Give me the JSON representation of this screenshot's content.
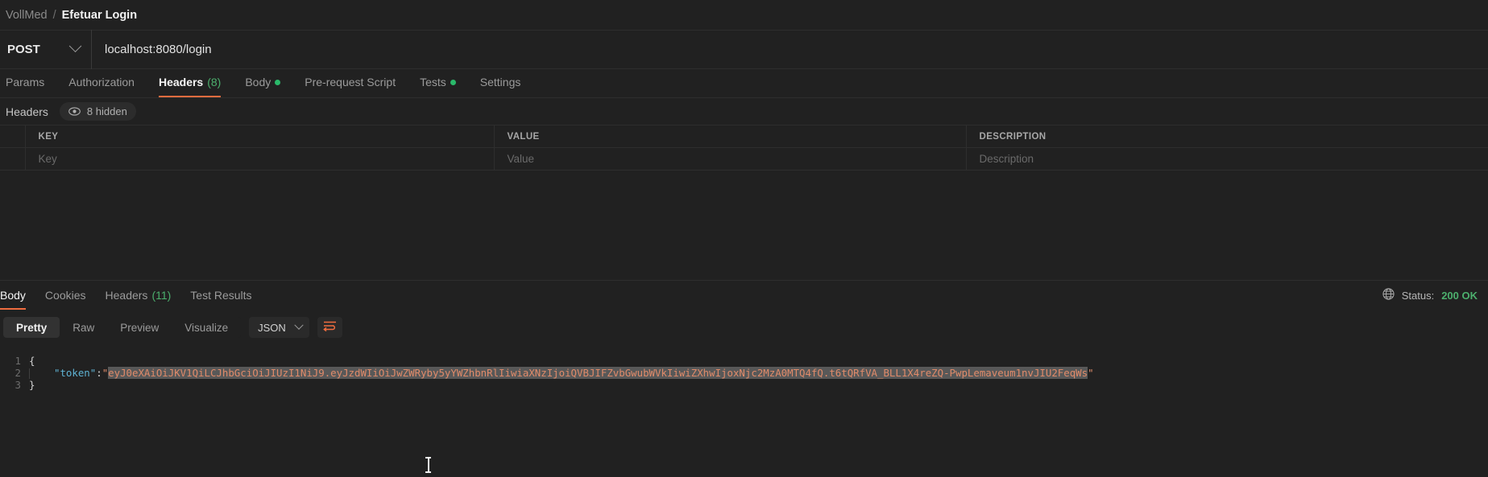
{
  "breadcrumb": {
    "collection": "VollMed",
    "separator": "/",
    "request": "Efetuar Login"
  },
  "urlbar": {
    "method": "POST",
    "url": "localhost:8080/login"
  },
  "request_tabs": [
    {
      "label": "Params",
      "active": false
    },
    {
      "label": "Authorization",
      "active": false
    },
    {
      "label": "Headers",
      "count": "(8)",
      "active": true
    },
    {
      "label": "Body",
      "dot": true,
      "active": false
    },
    {
      "label": "Pre-request Script",
      "active": false
    },
    {
      "label": "Tests",
      "dot": true,
      "active": false
    },
    {
      "label": "Settings",
      "active": false
    }
  ],
  "headers_section": {
    "label": "Headers",
    "hidden_badge": "8 hidden",
    "eye_icon": "eye-icon",
    "columns": [
      "KEY",
      "VALUE",
      "DESCRIPTION"
    ],
    "placeholder_row": {
      "key": "Key",
      "value": "Value",
      "description": "Description"
    }
  },
  "response_tabs": [
    {
      "label": "Body",
      "active": true
    },
    {
      "label": "Cookies",
      "active": false
    },
    {
      "label": "Headers",
      "count": "(11)",
      "active": false
    },
    {
      "label": "Test Results",
      "active": false
    }
  ],
  "response_status": {
    "globe_icon": "globe-icon",
    "label": "Status:",
    "value": "200 OK"
  },
  "body_toolbar": {
    "views": [
      {
        "label": "Pretty",
        "active": true
      },
      {
        "label": "Raw",
        "active": false
      },
      {
        "label": "Preview",
        "active": false
      },
      {
        "label": "Visualize",
        "active": false
      }
    ],
    "format": "JSON",
    "wrap_icon": "word-wrap-icon"
  },
  "response_body": {
    "line_numbers": [
      "1",
      "2",
      "3"
    ],
    "open_brace": "{",
    "close_brace": "}",
    "token_key": "\"token\"",
    "colon": ":",
    "quote": "\"",
    "token_value": "eyJ0eXAiOiJKV1QiLCJhbGciOiJIUzI1NiJ9.eyJzdWIiOiJwZWRyby5yYWZhbnRlIiwiaXNzIjoiQVBJIFZvbGwubWVkIiwiZXhwIjoxNjc2MzA0MTQ4fQ.t6tQRfVA_BLL1X4reZQ-PwpLemaveum1nvJIU2FeqWs"
  },
  "colors": {
    "accent": "#ef6c3f",
    "success": "#4caf6d",
    "background": "#212121",
    "string": "#e08b6a",
    "key": "#5fb3d4"
  }
}
